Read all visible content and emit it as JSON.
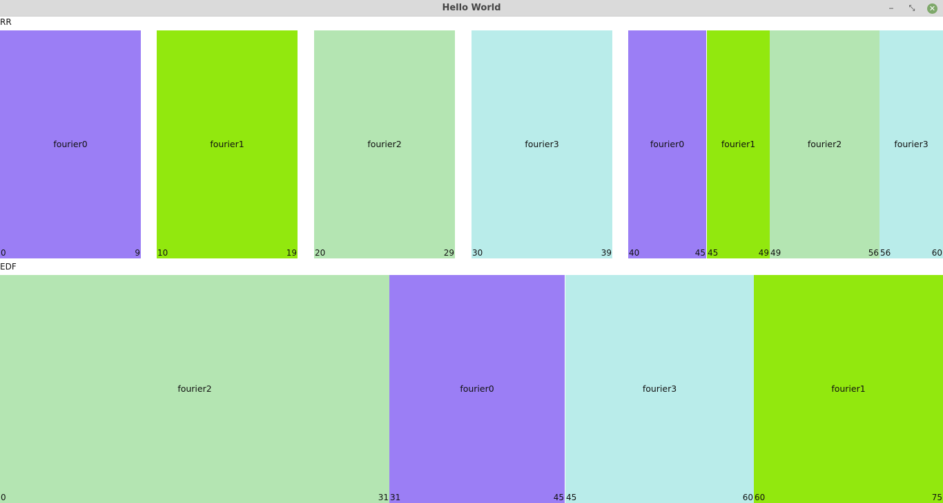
{
  "window": {
    "title": "Hello World",
    "minimize_glyph": "‒",
    "maximize_glyph": "⤡",
    "close_glyph": "✕"
  },
  "colors": {
    "fourier0": "#9b7ef5",
    "fourier1": "#92e80e",
    "fourier2": "#b4e5b2",
    "fourier3": "#b9ecea"
  },
  "rr": {
    "label": "RR",
    "blocks": [
      {
        "name": "fourier0",
        "start": "0",
        "end": "9"
      },
      {
        "name": "fourier1",
        "start": "10",
        "end": "19"
      },
      {
        "name": "fourier2",
        "start": "20",
        "end": "29"
      },
      {
        "name": "fourier3",
        "start": "30",
        "end": "39"
      },
      {
        "name": "fourier0",
        "start": "40",
        "end": "45"
      },
      {
        "name": "fourier1",
        "start": "45",
        "end": "49"
      },
      {
        "name": "fourier2",
        "start": "49",
        "end": "56"
      },
      {
        "name": "fourier3",
        "start": "56",
        "end": "60"
      }
    ]
  },
  "edf": {
    "label": "EDF",
    "blocks": [
      {
        "name": "fourier2",
        "start": "0",
        "end": "31"
      },
      {
        "name": "fourier0",
        "start": "31",
        "end": "45"
      },
      {
        "name": "fourier3",
        "start": "45",
        "end": "60"
      },
      {
        "name": "fourier1",
        "start": "60",
        "end": "75"
      }
    ]
  }
}
